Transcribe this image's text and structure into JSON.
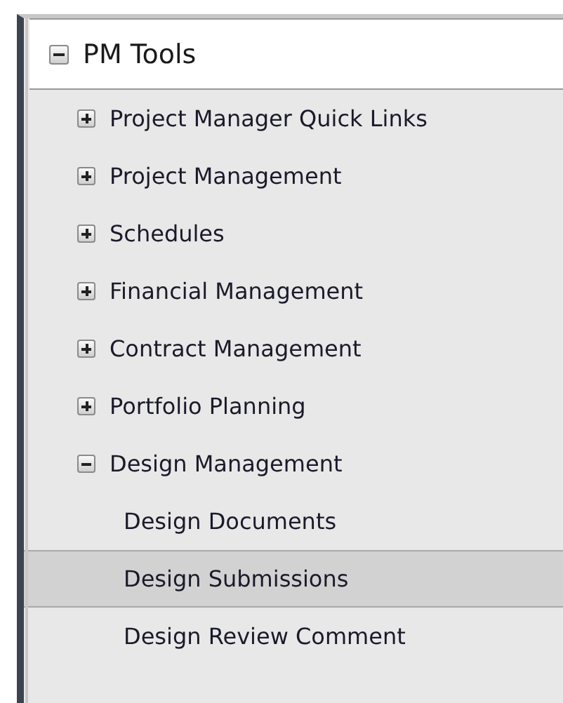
{
  "tree": {
    "label": "PM Tools",
    "expanded": true,
    "children": [
      {
        "label": "Project Manager Quick Links",
        "expanded": false
      },
      {
        "label": "Project Management",
        "expanded": false
      },
      {
        "label": "Schedules",
        "expanded": false
      },
      {
        "label": "Financial Management",
        "expanded": false
      },
      {
        "label": "Contract Management",
        "expanded": false
      },
      {
        "label": "Portfolio Planning",
        "expanded": false
      },
      {
        "label": "Design Management",
        "expanded": true,
        "children": [
          {
            "label": "Design Documents",
            "selected": false
          },
          {
            "label": "Design Submissions",
            "selected": true
          },
          {
            "label": "Design Review Comment",
            "selected": false
          }
        ]
      }
    ]
  }
}
